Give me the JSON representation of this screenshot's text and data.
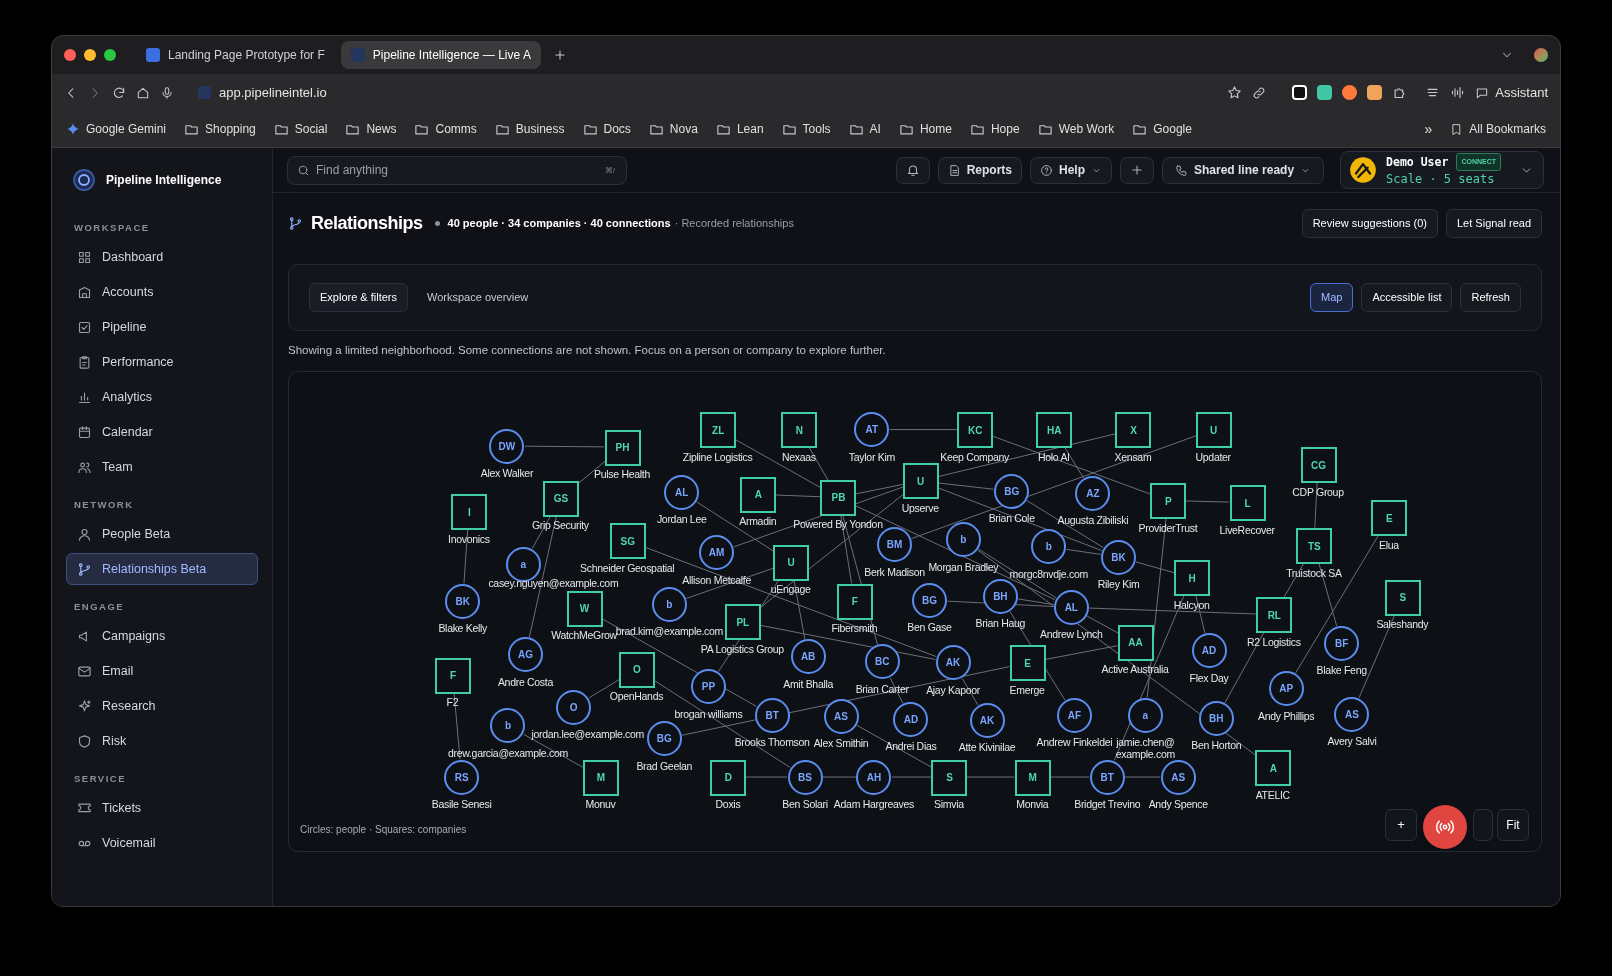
{
  "browser": {
    "tabs": [
      {
        "title": "Landing Page Prototype for F",
        "selected": false
      },
      {
        "title": "Pipeline Intelligence — Live A",
        "selected": true
      }
    ],
    "url": "app.pipelineintel.io",
    "assistant": "Assistant",
    "bookmarks": [
      {
        "label": "Google Gemini",
        "kind": "gemini"
      },
      {
        "label": "Shopping",
        "kind": "folder"
      },
      {
        "label": "Social",
        "kind": "folder"
      },
      {
        "label": "News",
        "kind": "folder"
      },
      {
        "label": "Comms",
        "kind": "folder"
      },
      {
        "label": "Business",
        "kind": "folder"
      },
      {
        "label": "Docs",
        "kind": "folder"
      },
      {
        "label": "Nova",
        "kind": "folder"
      },
      {
        "label": "Lean",
        "kind": "folder"
      },
      {
        "label": "Tools",
        "kind": "folder"
      },
      {
        "label": "AI",
        "kind": "folder"
      },
      {
        "label": "Home",
        "kind": "folder"
      },
      {
        "label": "Hope",
        "kind": "folder"
      },
      {
        "label": "Web Work",
        "kind": "folder"
      },
      {
        "label": "Google",
        "kind": "folder"
      }
    ],
    "more_bookmarks": "»",
    "all_bookmarks": "All Bookmarks"
  },
  "sidebar": {
    "brand": "Pipeline Intelligence",
    "sections": [
      {
        "title": "WORKSPACE",
        "items": [
          {
            "label": "Dashboard",
            "selected": false
          },
          {
            "label": "Accounts",
            "selected": false
          },
          {
            "label": "Pipeline",
            "selected": false
          },
          {
            "label": "Performance",
            "selected": false
          },
          {
            "label": "Analytics",
            "selected": false
          },
          {
            "label": "Calendar",
            "selected": false
          },
          {
            "label": "Team",
            "selected": false
          }
        ]
      },
      {
        "title": "NETWORK",
        "items": [
          {
            "label": "People Beta",
            "selected": false
          },
          {
            "label": "Relationships Beta",
            "selected": true
          }
        ]
      },
      {
        "title": "ENGAGE",
        "items": [
          {
            "label": "Campaigns",
            "selected": false
          },
          {
            "label": "Email",
            "selected": false
          },
          {
            "label": "Research",
            "selected": false
          },
          {
            "label": "Risk",
            "selected": false
          }
        ]
      },
      {
        "title": "SERVICE",
        "items": [
          {
            "label": "Tickets",
            "selected": false
          },
          {
            "label": "Voicemail",
            "selected": false
          }
        ]
      }
    ]
  },
  "header": {
    "search_placeholder": "Find anything",
    "shortcut": "⌘/",
    "reports": "Reports",
    "help": "Help",
    "line_status": "Shared line ready",
    "user": {
      "name": "Demo User",
      "badge": "CONNECT",
      "plan": "Scale · 5 seats"
    }
  },
  "page": {
    "title": "Relationships",
    "stats": "40 people · 34 companies · 40 connections",
    "subtitle": "· Recorded relationships",
    "actions": [
      "Review suggestions (0)",
      "Let Signal read"
    ]
  },
  "toolbar": {
    "tabs": [
      {
        "label": "Explore & filters",
        "selected": true
      },
      {
        "label": "Workspace overview",
        "selected": false
      }
    ],
    "views": [
      {
        "label": "Map",
        "selected": true
      },
      {
        "label": "Accessible list",
        "selected": false
      }
    ],
    "refresh": "Refresh"
  },
  "notice": "Showing a limited neighborhood. Some connections are not shown. Focus on a person or company to explore further.",
  "graph": {
    "legend": "Circles: people · Squares: companies",
    "zoom_in": "+",
    "fit": "Fit",
    "nodes": [
      {
        "kind": "person",
        "initials": "DW",
        "label": "Alex Walker"
      },
      {
        "kind": "company",
        "initials": "PH",
        "label": "Pulse Health"
      },
      {
        "kind": "company",
        "initials": "ZL",
        "label": "Zipline Logistics"
      },
      {
        "kind": "company",
        "initials": "N",
        "label": "Nexaas"
      },
      {
        "kind": "person",
        "initials": "AT",
        "label": "Taylor Kim"
      },
      {
        "kind": "company",
        "initials": "KC",
        "label": "Keep Company"
      },
      {
        "kind": "company",
        "initials": "HA",
        "label": "Holo AI"
      },
      {
        "kind": "company",
        "initials": "X",
        "label": "Xensam"
      },
      {
        "kind": "company",
        "initials": "U",
        "label": "Updater"
      },
      {
        "kind": "company",
        "initials": "CG",
        "label": "CDP Group"
      },
      {
        "kind": "company",
        "initials": "GS",
        "label": "Grip Security"
      },
      {
        "kind": "company",
        "initials": "I",
        "label": "Inovonics"
      },
      {
        "kind": "person",
        "initials": "AL",
        "label": "Jordan Lee"
      },
      {
        "kind": "company",
        "initials": "A",
        "label": "Armadin"
      },
      {
        "kind": "company",
        "initials": "PB",
        "label": "Powered By Yondon"
      },
      {
        "kind": "company",
        "initials": "U",
        "label": "Upserve"
      },
      {
        "kind": "person",
        "initials": "BG",
        "label": "Brian Cole"
      },
      {
        "kind": "person",
        "initials": "AZ",
        "label": "Augusta Zibiliski"
      },
      {
        "kind": "company",
        "initials": "P",
        "label": "ProviderTrust"
      },
      {
        "kind": "company",
        "initials": "L",
        "label": "LiveRecover"
      },
      {
        "kind": "company",
        "initials": "E",
        "label": "Elua"
      },
      {
        "kind": "company",
        "initials": "SG",
        "label": "Schneider Geospatial"
      },
      {
        "kind": "person",
        "initials": "a",
        "label": "casey.nguyen@example.com"
      },
      {
        "kind": "person",
        "initials": "AM",
        "label": "Allison Metcalfe"
      },
      {
        "kind": "person",
        "initials": "BM",
        "label": "Berk Madison"
      },
      {
        "kind": "person",
        "initials": "b",
        "label": "Morgan Bradley"
      },
      {
        "kind": "person",
        "initials": "b",
        "label": "morgc8nvdje.com"
      },
      {
        "kind": "person",
        "initials": "BK",
        "label": "Riley Kim"
      },
      {
        "kind": "company",
        "initials": "TS",
        "label": "Truistock SA"
      },
      {
        "kind": "company",
        "initials": "U",
        "label": "uEngage"
      },
      {
        "kind": "person",
        "initials": "BK",
        "label": "Blake Kelly"
      },
      {
        "kind": "company",
        "initials": "W",
        "label": "WatchMeGrow"
      },
      {
        "kind": "person",
        "initials": "b",
        "label": "brad.kim@example.com"
      },
      {
        "kind": "company",
        "initials": "PL",
        "label": "PA Logistics Group"
      },
      {
        "kind": "company",
        "initials": "F",
        "label": "Fibersmith"
      },
      {
        "kind": "person",
        "initials": "BG",
        "label": "Ben Gase"
      },
      {
        "kind": "person",
        "initials": "BH",
        "label": "Brian Haug"
      },
      {
        "kind": "person",
        "initials": "AL",
        "label": "Andrew Lynch"
      },
      {
        "kind": "company",
        "initials": "H",
        "label": "Halcyon"
      },
      {
        "kind": "company",
        "initials": "RL",
        "label": "R2 Logistics"
      },
      {
        "kind": "company",
        "initials": "S",
        "label": "Saleshandy"
      },
      {
        "kind": "person",
        "initials": "AG",
        "label": "Andre Costa"
      },
      {
        "kind": "person",
        "initials": "AB",
        "label": "Amit Bhalla"
      },
      {
        "kind": "person",
        "initials": "BC",
        "label": "Brian Carter"
      },
      {
        "kind": "person",
        "initials": "AK",
        "label": "Ajay Kapoor"
      },
      {
        "kind": "company",
        "initials": "E",
        "label": "Emerge"
      },
      {
        "kind": "company",
        "initials": "AA",
        "label": "Active Australia"
      },
      {
        "kind": "person",
        "initials": "AD",
        "label": "Flex Day"
      },
      {
        "kind": "person",
        "initials": "BF",
        "label": "Blake Feng"
      },
      {
        "kind": "company",
        "initials": "F",
        "label": "F2"
      },
      {
        "kind": "company",
        "initials": "O",
        "label": "OpenHands"
      },
      {
        "kind": "person",
        "initials": "PP",
        "label": "brogan williams"
      },
      {
        "kind": "person",
        "initials": "O",
        "label": "jordan.lee@example.com"
      },
      {
        "kind": "person",
        "initials": "BT",
        "label": "Brooks Thomson"
      },
      {
        "kind": "person",
        "initials": "AS",
        "label": "Alex Smithin"
      },
      {
        "kind": "person",
        "initials": "AD",
        "label": "Andrei Dias"
      },
      {
        "kind": "person",
        "initials": "AK",
        "label": "Atte Kivinilae"
      },
      {
        "kind": "person",
        "initials": "AF",
        "label": "Andrew Finkeldei"
      },
      {
        "kind": "person",
        "initials": "a",
        "label": "jamie.chen@\nexample.com"
      },
      {
        "kind": "person",
        "initials": "BH",
        "label": "Ben Horton"
      },
      {
        "kind": "person",
        "initials": "AP",
        "label": "Andy Phillips"
      },
      {
        "kind": "person",
        "initials": "AS",
        "label": "Avery Salvi"
      },
      {
        "kind": "person",
        "initials": "b",
        "label": "drew.garcia@example.com"
      },
      {
        "kind": "person",
        "initials": "BG",
        "label": "Brad Geelan"
      },
      {
        "kind": "company",
        "initials": "A",
        "label": "ATELIC"
      },
      {
        "kind": "person",
        "initials": "RS",
        "label": "Basile Senesi"
      },
      {
        "kind": "company",
        "initials": "M",
        "label": "Monuv"
      },
      {
        "kind": "company",
        "initials": "D",
        "label": "Doxis"
      },
      {
        "kind": "person",
        "initials": "BS",
        "label": "Ben Solari"
      },
      {
        "kind": "person",
        "initials": "AH",
        "label": "Adam Hargreaves"
      },
      {
        "kind": "company",
        "initials": "S",
        "label": "Simvia"
      },
      {
        "kind": "company",
        "initials": "M",
        "label": "Monvia"
      },
      {
        "kind": "person",
        "initials": "BT",
        "label": "Bridget Trevino"
      },
      {
        "kind": "person",
        "initials": "AS",
        "label": "Andy Spence"
      }
    ]
  }
}
